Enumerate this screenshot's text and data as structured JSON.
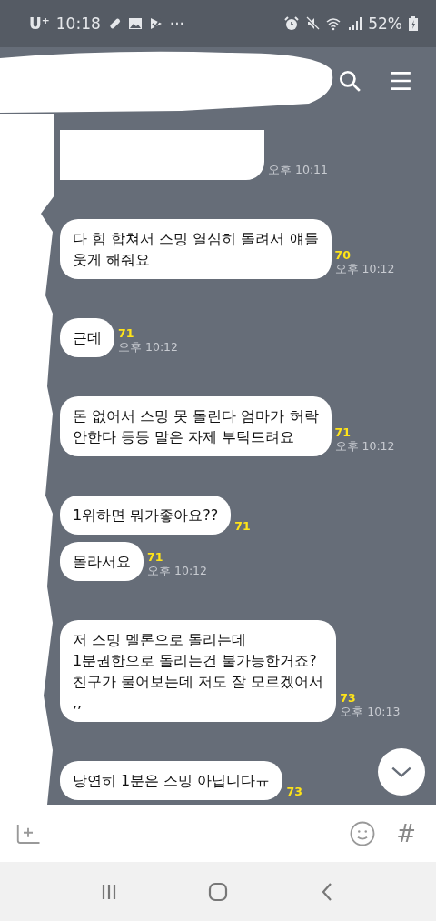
{
  "status_bar": {
    "carrier": "U⁺",
    "time": "10:18",
    "more": "···",
    "battery": "52%"
  },
  "messages": [
    {
      "time": "오후 10:11"
    },
    {
      "text": "다 힘 합쳐서 스밍 열심히 돌려서 얘들\n웃게 해줘요",
      "unread": "70",
      "time": "오후 10:12"
    },
    {
      "text": "근데",
      "unread": "71",
      "time": "오후 10:12"
    },
    {
      "text": "돈 없어서 스밍 못 돌린다 엄마가 허락\n안한다 등등 말은 자제 부탁드려요",
      "unread": "71",
      "time": "오후 10:12"
    },
    {
      "text": "1위하면 뭐가좋아요??",
      "unread": "71"
    },
    {
      "text": "몰라서요",
      "unread": "71",
      "time": "오후 10:12"
    },
    {
      "text": "저 스밍 멜론으로 돌리는데\n1분권한으로 돌리는건 불가능한거죠?\n친구가 물어보는데 저도 잘 모르겠어서\n,,",
      "unread": "73",
      "time": "오후 10:13"
    },
    {
      "text": "당연히 1분은 스밍 아닙니다ㅠ",
      "unread": "73"
    }
  ],
  "input_bar": {
    "hash": "#"
  }
}
